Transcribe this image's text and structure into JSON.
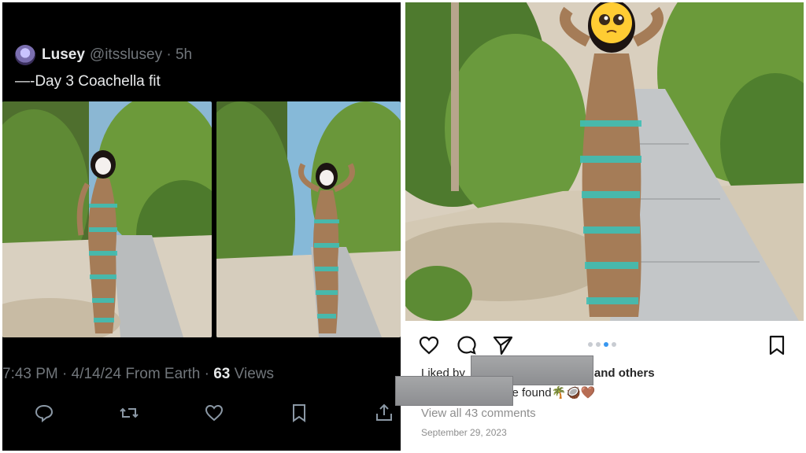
{
  "tweet": {
    "display_name": "Lusey",
    "handle_time": "@itsslusey · 5h",
    "text": "—-Day 3 Coachella fit",
    "meta_time": "7:43 PM · 4/14/24 From Earth · ",
    "views_count": "63",
    "views_label": " Views",
    "actions": [
      "reply-icon",
      "retweet-icon",
      "like-icon",
      "bookmark-icon",
      "share-icon"
    ]
  },
  "instagram": {
    "liked_prefix": "Liked by",
    "liked_suffix": "and others",
    "caption_text": "se found",
    "caption_emoji": "🌴🥥🤎",
    "view_comments": "View all 43 comments",
    "date": "September 29, 2023",
    "carousel": {
      "count": 4,
      "active": 3
    },
    "actions": [
      "heart-icon",
      "comment-icon",
      "send-icon",
      "save-icon"
    ]
  },
  "colors": {
    "twitter_bg": "#000000",
    "twitter_text": "#e7e9ea",
    "twitter_muted": "#71767b",
    "ig_blue": "#3897f0",
    "dress_teal": "#3fbfb5",
    "dress_tan": "#a57c57"
  }
}
